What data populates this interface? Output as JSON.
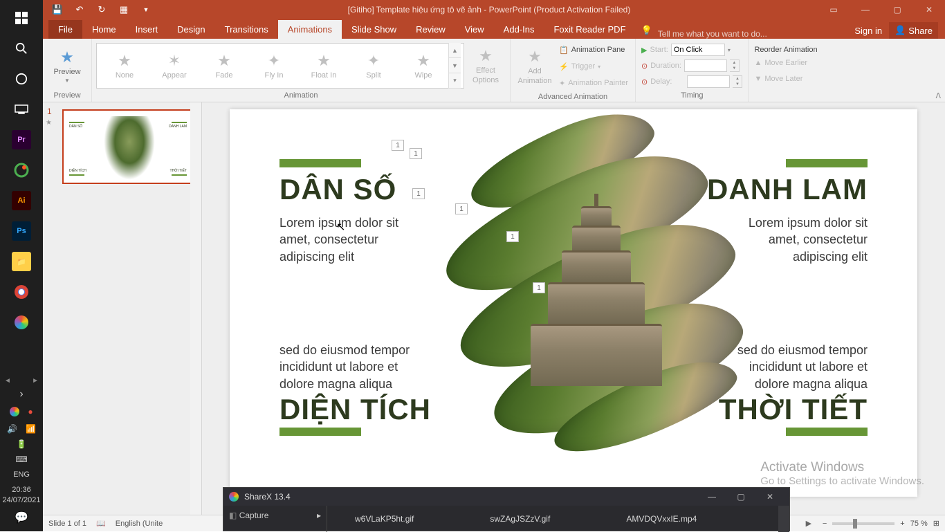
{
  "titlebar": {
    "title": "[Gitiho] Template hiệu ứng tô vẽ ảnh - PowerPoint (Product Activation Failed)",
    "signin": "Sign in",
    "share": "Share"
  },
  "tabs": {
    "file": "File",
    "home": "Home",
    "insert": "Insert",
    "design": "Design",
    "transitions": "Transitions",
    "animations": "Animations",
    "slideshow": "Slide Show",
    "review": "Review",
    "view": "View",
    "addins": "Add-Ins",
    "foxit": "Foxit Reader PDF",
    "tellme": "Tell me what you want to do..."
  },
  "ribbon": {
    "preview": "Preview",
    "preview_label": "Preview",
    "anim_none": "None",
    "anim_appear": "Appear",
    "anim_fade": "Fade",
    "anim_flyin": "Fly In",
    "anim_floatin": "Float In",
    "anim_split": "Split",
    "anim_wipe": "Wipe",
    "effect_options": "Effect",
    "effect_options2": "Options",
    "animation_label": "Animation",
    "add_anim": "Add",
    "add_anim2": "Animation",
    "anim_pane": "Animation Pane",
    "trigger": "Trigger",
    "anim_painter": "Animation Painter",
    "adv_label": "Advanced Animation",
    "start": "Start:",
    "start_val": "On Click",
    "duration": "Duration:",
    "delay": "Delay:",
    "timing_label": "Timing",
    "reorder": "Reorder Animation",
    "move_earlier": "Move Earlier",
    "move_later": "Move Later"
  },
  "thumbnail": {
    "num": "1",
    "star": "★",
    "t1": "DÂN SỐ",
    "t2": "DANH LAM",
    "t3": "DIỆN TÍCH",
    "t4": "THỜI TIẾT"
  },
  "slide": {
    "title1": "DÂN SỐ",
    "text1": "Lorem ipsum dolor sit amet, consectetur adipiscing elit",
    "text1b": "sed do eiusmod tempor incididunt ut labore et dolore magna aliqua",
    "title1b": "DIỆN TÍCH",
    "title2": "DANH LAM",
    "text2": "Lorem ipsum dolor sit amet, consectetur adipiscing elit",
    "text2b": "sed do eiusmod tempor incididunt ut labore et dolore magna aliqua",
    "title2b": "THỜI TIẾT",
    "tags": [
      "1",
      "1",
      "1",
      "1",
      "1",
      "1"
    ]
  },
  "watermark": {
    "line1": "Activate Windows",
    "line2": "Go to Settings to activate Windows."
  },
  "status": {
    "slide": "Slide 1 of 1",
    "lang": "English (Unite",
    "zoom": "75 %"
  },
  "sharex": {
    "title": "ShareX 13.4",
    "capture": "Capture",
    "files": [
      "w6VLaKP5ht.gif",
      "swZAgJSZzV.gif",
      "AMVDQVxxIE.mp4"
    ]
  },
  "taskbar": {
    "lang": "ENG",
    "time": "20:36",
    "date": "24/07/2021"
  }
}
